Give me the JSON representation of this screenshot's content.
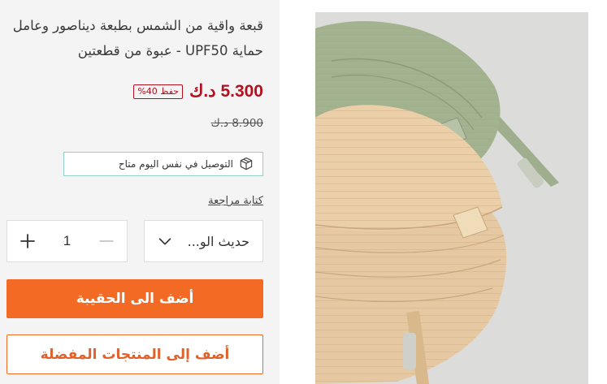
{
  "product": {
    "title": "قبعة واقية من الشمس بطبعة ديناصور وعامل حماية UPF50 - عبوة من قطعتين",
    "price": "5.300 د.ك",
    "save_badge": "حفظ 40%",
    "old_price": "8.900 د.ك",
    "delivery_text": "التوصيل في نفس اليوم متاح",
    "review_link": "كتابة مراجعة",
    "colors": {
      "price": "#b30f1e",
      "accent": "#f26a23",
      "delivery_border": "#93d1c6"
    }
  },
  "variant": {
    "selected": "حديث الو..."
  },
  "quantity": {
    "value": "1"
  },
  "buttons": {
    "add_to_bag": "أضف الى الحقيبة",
    "add_to_favorites": "أضف إلى المنتجات المفضلة"
  },
  "icons": {
    "delivery": "box-icon",
    "variant": "chevron-down-icon",
    "minus": "minus-icon",
    "plus": "plus-icon"
  }
}
